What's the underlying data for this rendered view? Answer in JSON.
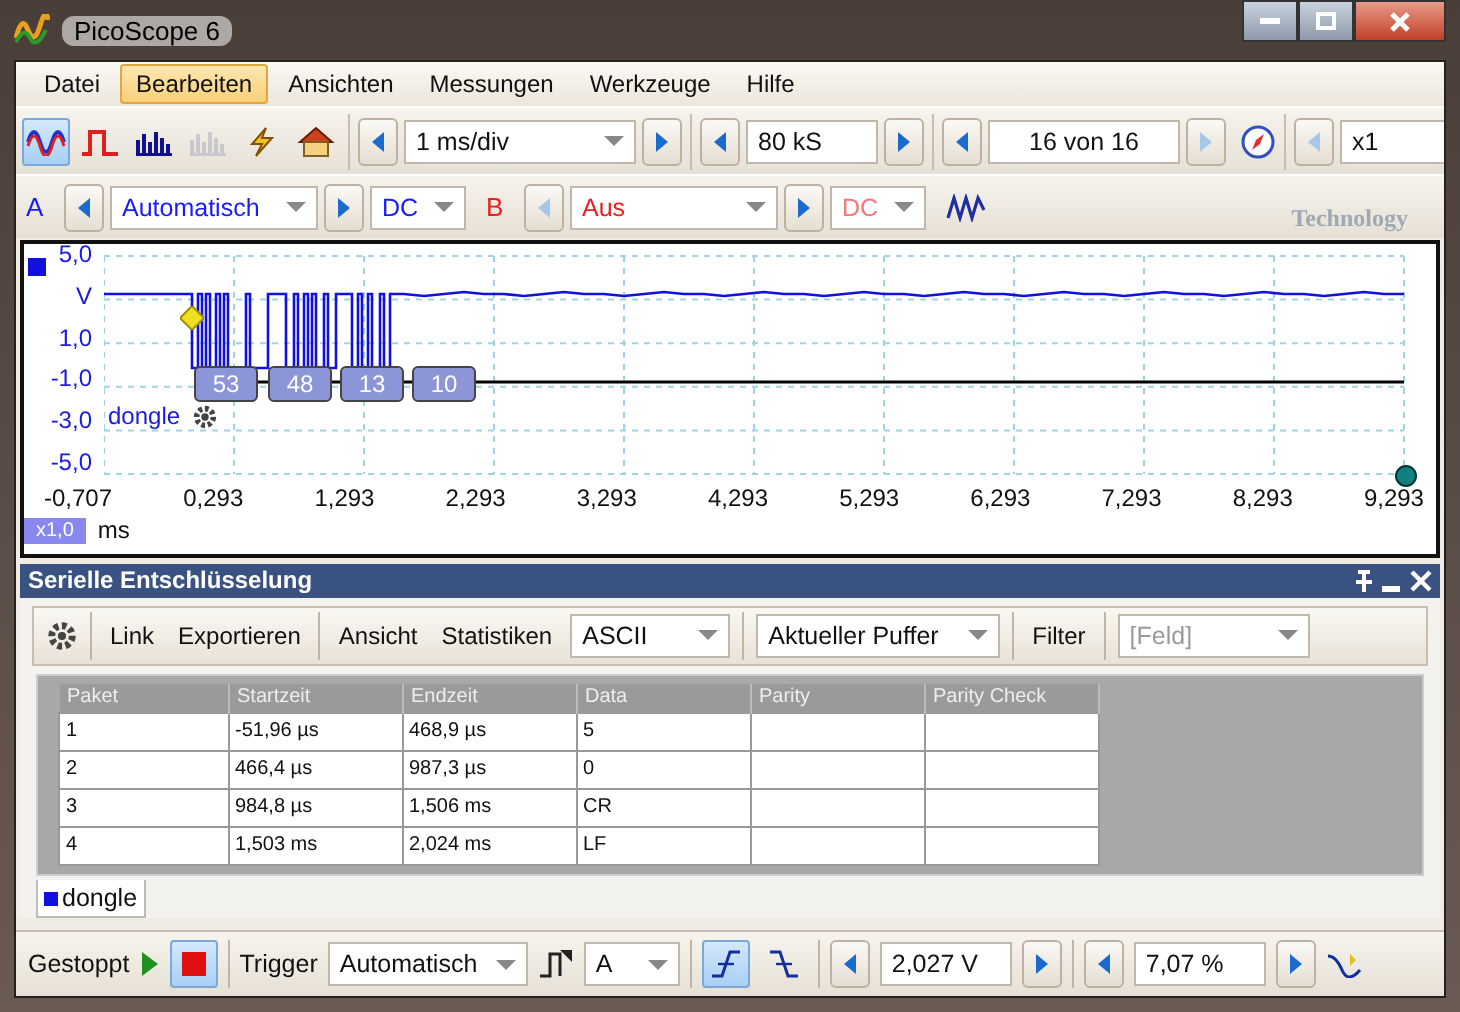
{
  "window": {
    "title": "PicoScope 6"
  },
  "menu": [
    {
      "label": "Datei",
      "selected": false
    },
    {
      "label": "Bearbeiten",
      "selected": true
    },
    {
      "label": "Ansichten",
      "selected": false
    },
    {
      "label": "Messungen",
      "selected": false
    },
    {
      "label": "Werkzeuge",
      "selected": false
    },
    {
      "label": "Hilfe",
      "selected": false
    }
  ],
  "tools": [
    {
      "kind": "sine",
      "selected": true,
      "disabled": false
    },
    {
      "kind": "pulse",
      "selected": false,
      "disabled": false
    },
    {
      "kind": "bars",
      "selected": false,
      "disabled": false
    },
    {
      "kind": "bars",
      "selected": false,
      "disabled": true
    },
    {
      "kind": "lightning",
      "selected": false,
      "disabled": false
    },
    {
      "kind": "home",
      "selected": false,
      "disabled": false
    }
  ],
  "timebase": "1 ms/div",
  "samples": "80 kS",
  "buffer": "16 von 16",
  "zoom": "x1",
  "channels": [
    {
      "label": "A",
      "range": "Automatisch",
      "coupling": "DC",
      "color": "#1a1aff",
      "enabled": true
    },
    {
      "label": "B",
      "range": "Aus",
      "coupling": "DC",
      "color": "#e82020",
      "enabled": false
    }
  ],
  "logo_text": "Technology",
  "scope": {
    "y_labels": [
      "5,0",
      "V",
      "1,0",
      "-1,0",
      "-3,0",
      "-5,0"
    ],
    "x_labels": [
      "-0,707",
      "0,293",
      "1,293",
      "2,293",
      "3,293",
      "4,293",
      "5,293",
      "6,293",
      "7,293",
      "8,293",
      "9,293"
    ],
    "zoom_badge": "x1,0",
    "unit": "ms",
    "decoder_name": "dongle",
    "packets": [
      "53",
      "48",
      "13",
      "10"
    ]
  },
  "decoder": {
    "title": "Serielle Entschlüsselung",
    "actions": [
      "Link",
      "Exportieren"
    ],
    "views": [
      "Ansicht",
      "Statistiken"
    ],
    "format": "ASCII",
    "source": "Aktueller Puffer",
    "filter": "Filter",
    "field_placeholder": "[Feld]",
    "columns": [
      "Paket",
      "Startzeit",
      "Endzeit",
      "Data",
      "Parity",
      "Parity Check"
    ],
    "rows": [
      [
        "1",
        "-51,96 µs",
        "468,9 µs",
        "5",
        "",
        ""
      ],
      [
        "2",
        "466,4 µs",
        "987,3 µs",
        "0",
        "",
        ""
      ],
      [
        "3",
        "984,8 µs",
        "1,506 ms",
        "CR",
        "",
        ""
      ],
      [
        "4",
        "1,503 ms",
        "2,024 ms",
        "LF",
        "",
        ""
      ]
    ],
    "tabs": [
      {
        "label": "dongle",
        "selected": true
      }
    ]
  },
  "status": {
    "state": "Gestoppt",
    "trigger_label": "Trigger",
    "trigger_mode": "Automatisch",
    "trigger_channel": "A",
    "edges": [
      {
        "kind": "rising",
        "selected": true
      },
      {
        "kind": "falling",
        "selected": false
      }
    ],
    "threshold": "2,027 V",
    "pretrigger": "7,07 %"
  }
}
